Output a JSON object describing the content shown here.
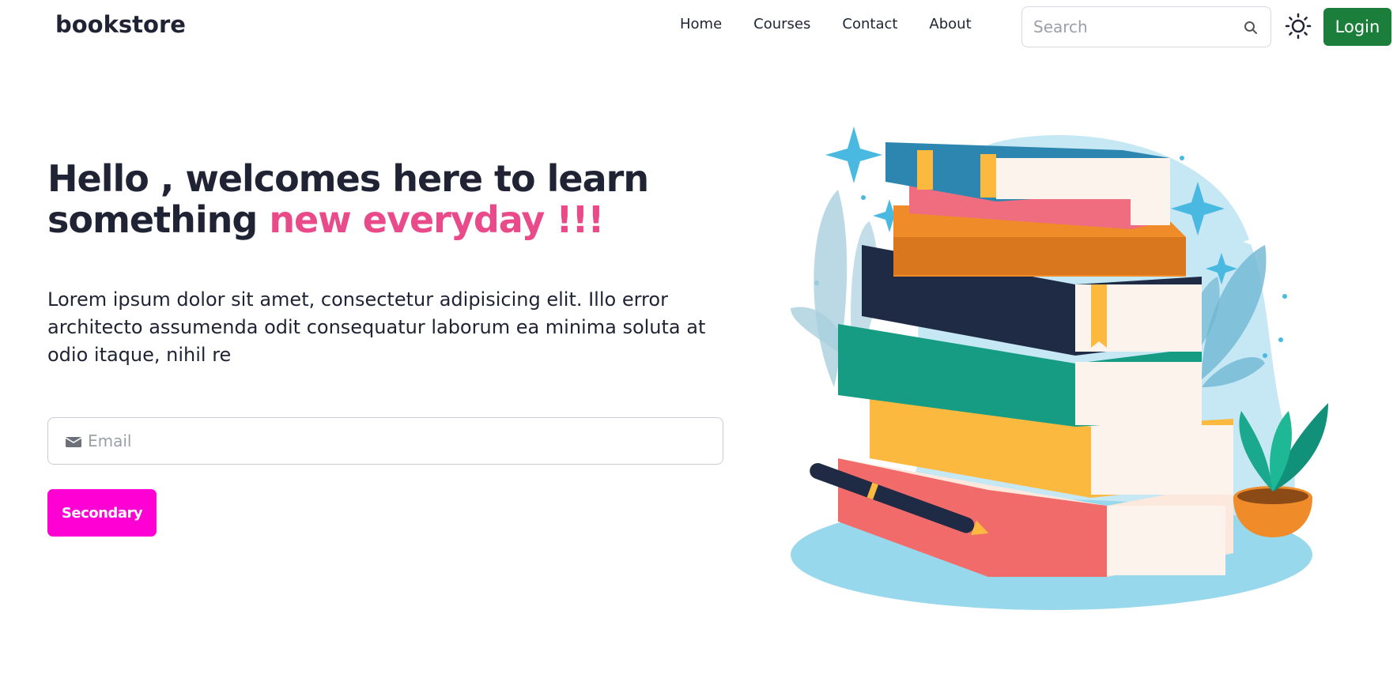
{
  "brand": {
    "name": "bookstore"
  },
  "nav": {
    "links": [
      {
        "label": "Home"
      },
      {
        "label": "Courses"
      },
      {
        "label": "Contact"
      },
      {
        "label": "About"
      }
    ],
    "search": {
      "placeholder": "Search",
      "icon": "search-icon"
    },
    "theme_toggle_icon": "sun-icon",
    "login_label": "Login"
  },
  "hero": {
    "title_main": "Hello , welcomes here to learn something",
    "title_accent": "new everyday !!!",
    "description": "Lorem ipsum dolor sit amet, consectetur adipisicing elit. Illo error architecto assumenda odit consequatur laborum ea minima soluta at odio itaque, nihil re",
    "email_placeholder": "Email",
    "email_icon": "mail-icon",
    "cta_label": "Secondary"
  },
  "colors": {
    "brand_text": "#1f2333",
    "accent_pink": "#e84a8a",
    "login_green": "#1b7f3b",
    "cta_magenta": "#ff00d4"
  }
}
